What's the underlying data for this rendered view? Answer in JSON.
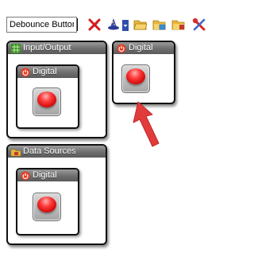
{
  "toolbar": {
    "name_field_value": "Debounce Button",
    "icons": [
      "delete-icon",
      "wizard-icon",
      "dropdown-arrow-icon",
      "folder-open-icon",
      "folder-add-icon",
      "folder-settings-icon",
      "tools-icon"
    ]
  },
  "panels": {
    "io": {
      "title": "Input/Output",
      "icon": "io-grid-icon",
      "widget": {
        "title": "Digital",
        "icon": "power-icon"
      }
    },
    "digital_standalone": {
      "title": "Digital",
      "icon": "power-icon"
    },
    "data_sources": {
      "title": "Data Sources",
      "icon": "data-sources-icon",
      "widget": {
        "title": "Digital",
        "icon": "power-icon"
      }
    }
  },
  "colors": {
    "header": "#6e6e6e",
    "button_red": "#e00000",
    "arrow": "#e23b3b"
  }
}
